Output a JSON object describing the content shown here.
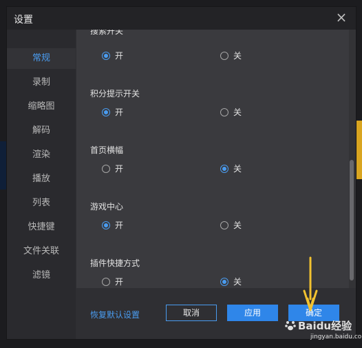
{
  "dialog": {
    "title": "设置",
    "close_icon": "close-icon"
  },
  "sidebar": {
    "items": [
      {
        "label": "常规",
        "active": true
      },
      {
        "label": "录制",
        "active": false
      },
      {
        "label": "缩略图",
        "active": false
      },
      {
        "label": "解码",
        "active": false
      },
      {
        "label": "渲染",
        "active": false
      },
      {
        "label": "播放",
        "active": false
      },
      {
        "label": "列表",
        "active": false
      },
      {
        "label": "快捷键",
        "active": false
      },
      {
        "label": "文件关联",
        "active": false
      },
      {
        "label": "滤镜",
        "active": false
      }
    ]
  },
  "sections": [
    {
      "title": "搜索开关",
      "options": [
        "开",
        "关"
      ],
      "selected": "开"
    },
    {
      "title": "积分提示开关",
      "options": [
        "开",
        "关"
      ],
      "selected": "开"
    },
    {
      "title": "首页横幅",
      "options": [
        "开",
        "关"
      ],
      "selected": "关"
    },
    {
      "title": "游戏中心",
      "options": [
        "开",
        "关"
      ],
      "selected": "开"
    },
    {
      "title": "插件快捷方式",
      "options": [
        "开",
        "关"
      ],
      "selected": "关"
    }
  ],
  "footer": {
    "restore_label": "恢复默认设置",
    "cancel_label": "取消",
    "apply_label": "应用",
    "ok_label": "确定"
  },
  "watermark": {
    "brand": "Baidu经验",
    "url": "jingyan.baidu.com"
  },
  "colors": {
    "accent": "#2f86e9",
    "highlight": "#4a9cf0",
    "arrow": "#f2c230"
  }
}
